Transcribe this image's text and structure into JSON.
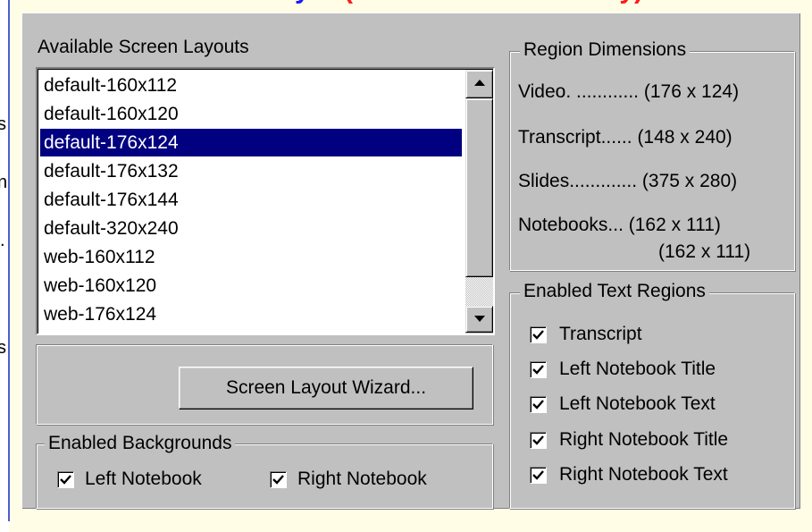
{
  "document": {
    "heading_fragments": [
      "y",
      "(",
      "y)"
    ],
    "left_edge_text": [
      "s",
      "n",
      ".",
      "s"
    ]
  },
  "layouts": {
    "label": "Available Screen Layouts",
    "items": [
      {
        "label": "default-160x112",
        "selected": false
      },
      {
        "label": "default-160x120",
        "selected": false
      },
      {
        "label": "default-176x124",
        "selected": true
      },
      {
        "label": "default-176x132",
        "selected": false
      },
      {
        "label": "default-176x144",
        "selected": false
      },
      {
        "label": "default-320x240",
        "selected": false
      },
      {
        "label": "web-160x112",
        "selected": false
      },
      {
        "label": "web-160x120",
        "selected": false
      },
      {
        "label": "web-176x124",
        "selected": false
      }
    ]
  },
  "wizard_button": {
    "label": "Screen Layout Wizard..."
  },
  "backgrounds": {
    "title": "Enabled Backgrounds",
    "items": [
      {
        "label": "Left Notebook",
        "checked": true
      },
      {
        "label": "Right Notebook",
        "checked": true
      }
    ]
  },
  "region_dimensions": {
    "title": "Region Dimensions",
    "rows": [
      {
        "name": "Video. ............",
        "value": "(176 x 124)"
      },
      {
        "name": "Transcript......",
        "value": "(148 x 240)"
      },
      {
        "name": "Slides.............",
        "value": "(375 x 280)"
      },
      {
        "name": "Notebooks...",
        "value": "(162 x 111)"
      },
      {
        "name": "",
        "value": "(162 x 111)"
      }
    ]
  },
  "text_regions": {
    "title": "Enabled Text Regions",
    "items": [
      {
        "label": "Transcript",
        "checked": true
      },
      {
        "label": "Left Notebook Title",
        "checked": true
      },
      {
        "label": "Left Notebook Text",
        "checked": true
      },
      {
        "label": "Right Notebook Title",
        "checked": true
      },
      {
        "label": "Right Notebook Text",
        "checked": true
      }
    ]
  },
  "colors": {
    "dialog_face": "#c0c0c0",
    "selection": "#000080",
    "page_background": "#fffde6",
    "heading_blue": "#1a1aff",
    "heading_red": "#ff1a1a"
  }
}
